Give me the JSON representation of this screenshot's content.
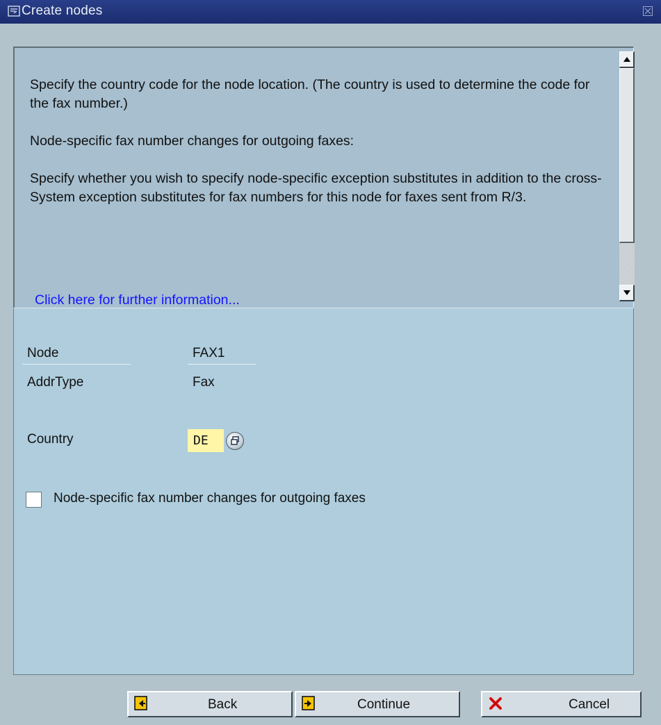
{
  "window": {
    "title": "Create nodes"
  },
  "help": {
    "paragraphs": [
      "Specify the country code for the node location. (The country is used to determine the code for the fax number.)",
      "Node-specific fax number changes for outgoing faxes:",
      "Specify whether you wish to specify node-specific exception substitutes in addition to the cross-System exception substitutes for fax numbers for this node for faxes sent from R/3."
    ],
    "link": "Click here for further information..."
  },
  "form": {
    "node_label": "Node",
    "node_value": "FAX1",
    "addrtype_label": "AddrType",
    "addrtype_value": "Fax",
    "country_label": "Country",
    "country_value": "DE",
    "checkbox_label": "Node-specific fax number changes for outgoing faxes",
    "checkbox_checked": false
  },
  "buttons": {
    "back": "Back",
    "continue": "Continue",
    "cancel": "Cancel"
  },
  "colors": {
    "titlebar": "#1b2c6e",
    "help_bg": "#a7bfcf",
    "form_bg": "#afcddd",
    "input_bg": "#fff6a8",
    "link": "#1414ff",
    "cancel_icon": "#e01010"
  }
}
